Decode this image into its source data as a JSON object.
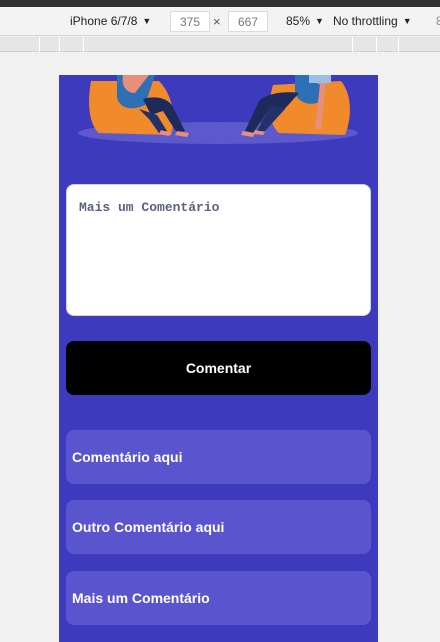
{
  "devtools": {
    "device": "iPhone 6/7/8",
    "width": "375",
    "height": "667",
    "zoom": "85%",
    "throttling": "No throttling",
    "overflow_label": "8"
  },
  "form": {
    "placeholder": "Mais um Comentário",
    "submit_label": "Comentar"
  },
  "comments": [
    "Comentário aqui",
    "Outro Comentário aqui",
    "Mais um Comentário"
  ],
  "colors": {
    "page_bg": "#3e3abd",
    "card_bg": "#5a55cf",
    "button_bg": "#000000"
  }
}
